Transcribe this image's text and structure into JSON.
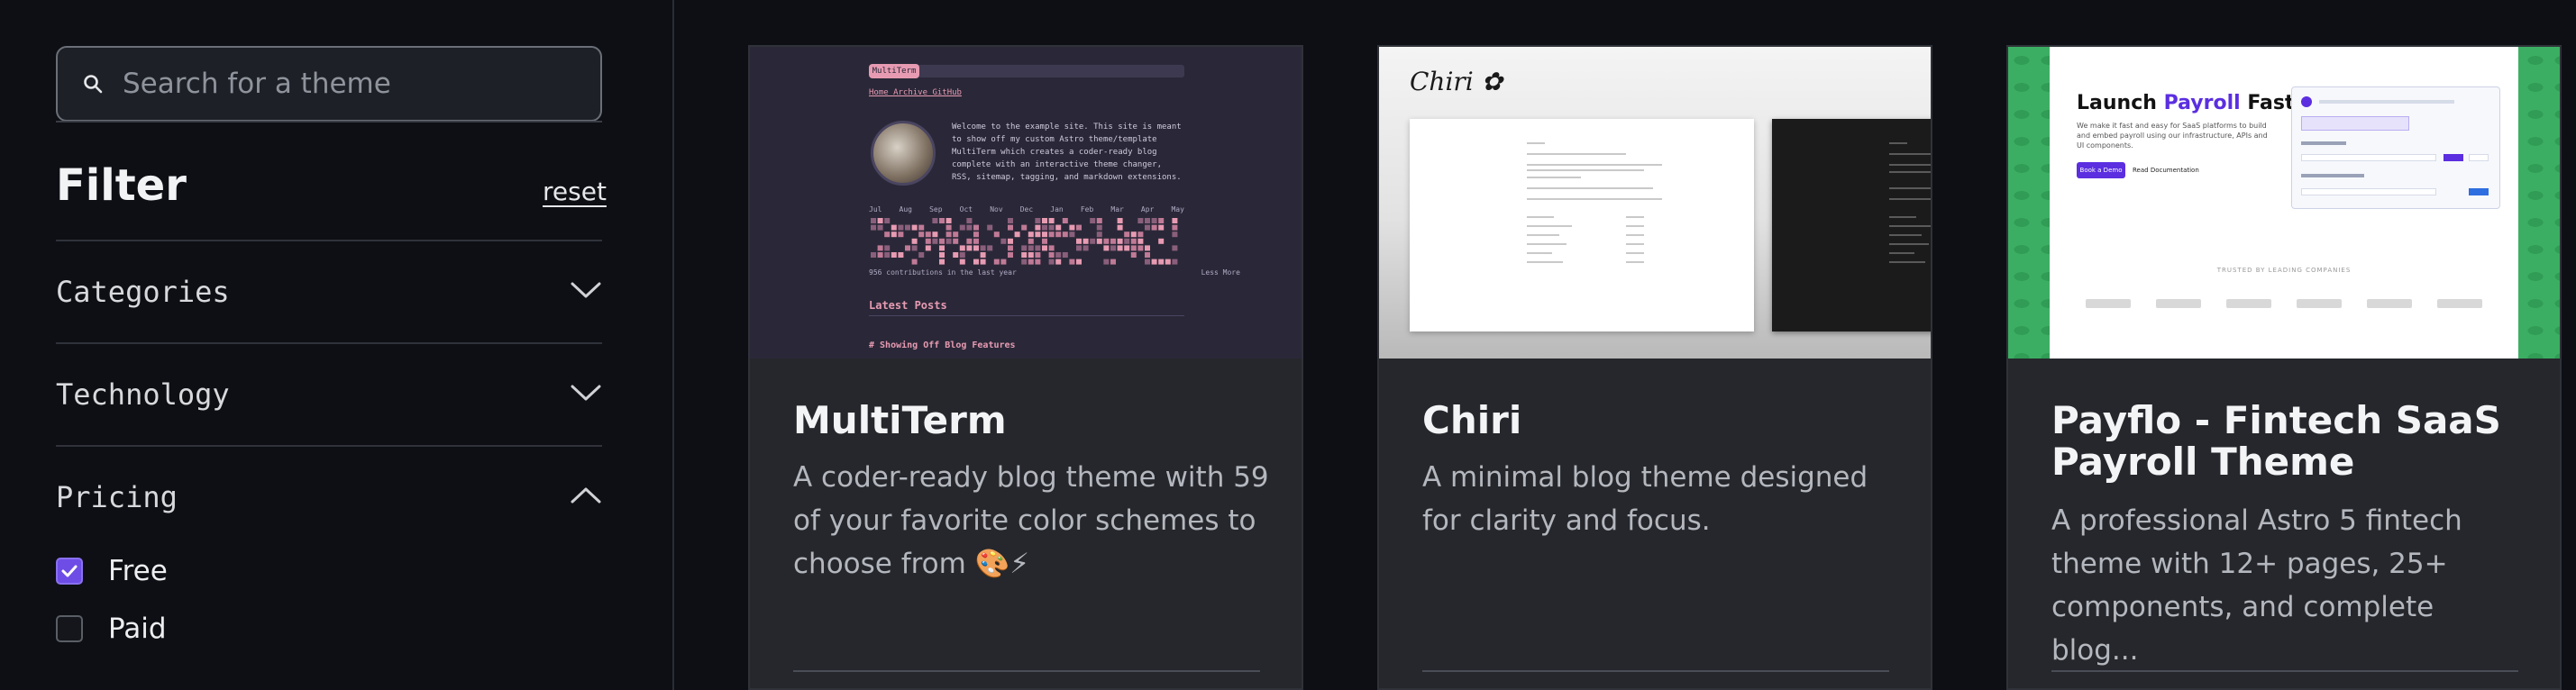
{
  "sidebar": {
    "search": {
      "placeholder": "Search for a theme",
      "icon": "search-icon"
    },
    "filter_title": "Filter",
    "reset_label": "reset",
    "sections": [
      {
        "label": "Categories",
        "icon": "chevron-down-icon",
        "expanded": false
      },
      {
        "label": "Technology",
        "icon": "chevron-down-icon",
        "expanded": false
      },
      {
        "label": "Pricing",
        "icon": "chevron-up-icon",
        "expanded": true
      }
    ],
    "pricing_options": [
      {
        "label": "Free",
        "checked": true
      },
      {
        "label": "Paid",
        "checked": false
      }
    ]
  },
  "cards": [
    {
      "title": "MultiTerm",
      "description": "A coder-ready blog theme with 59 of your favorite color schemes to choose from 🎨⚡",
      "thumbnail": {
        "tag": "MultiTerm",
        "nav": "Home  Archive  GitHub",
        "intro": "Welcome to the example site. This site is meant to show off my custom Astro theme/template MultiTerm which creates a coder-ready blog complete with an interactive theme changer, RSS, sitemap, tagging, and markdown extensions.",
        "months": [
          "Jul",
          "Aug",
          "Sep",
          "Oct",
          "Nov",
          "Dec",
          "Jan",
          "Feb",
          "Mar",
          "Apr",
          "May"
        ],
        "contributions": "956 contributions in the last year",
        "legend": "Less  More",
        "latest_heading": "Latest Posts",
        "post_heading": "# Showing Off Blog Features"
      }
    },
    {
      "title": "Chiri",
      "description": "A minimal blog theme designed for clarity and focus.",
      "thumbnail": {
        "logo": "Chiri ✿"
      }
    },
    {
      "title": "Payflo - Fintech SaaS Payroll Theme",
      "description": "A professional Astro 5 fintech theme with 12+ pages, 25+ components, and complete blog...",
      "thumbnail": {
        "hero_start": "Launch ",
        "hero_accent": "Payroll",
        "hero_end": " Fast",
        "subtext": "We make it fast and easy for SaaS platforms to build and embed payroll using our infrastructure, APIs and UI components.",
        "primary_button": "Book a Demo",
        "secondary_button": "Read Documentation",
        "trusted": "TRUSTED BY LEADING COMPANIES",
        "accent": "#5b2ee0"
      }
    }
  ],
  "colors": {
    "background": "#0d0f14",
    "card": "#25272c",
    "checkbox_accent": "#6d4de6",
    "multiterm_pink": "#e79bb2",
    "payflo_green": "#3cae63"
  }
}
